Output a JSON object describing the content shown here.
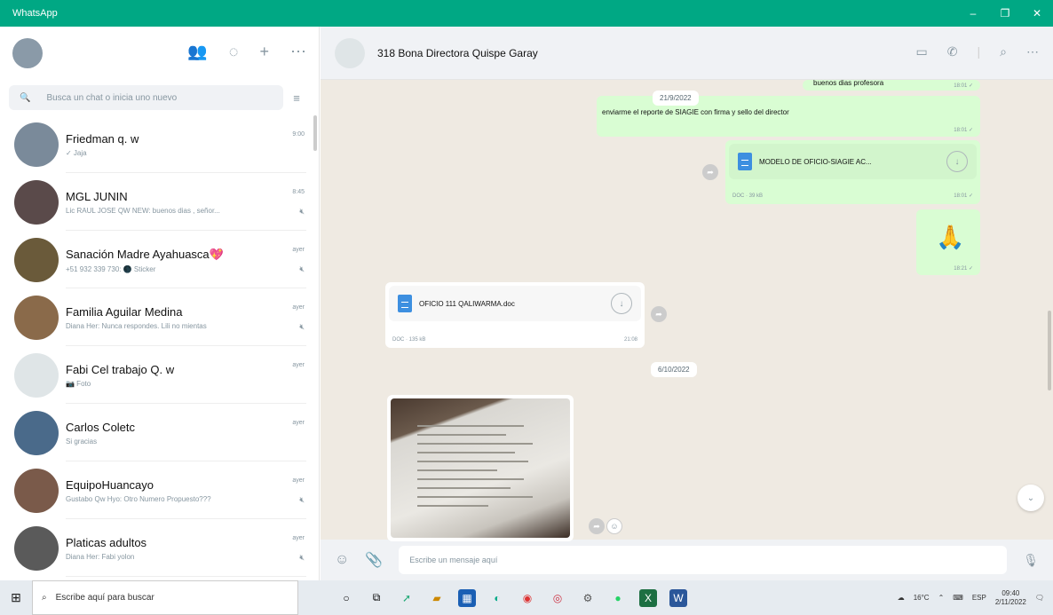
{
  "window": {
    "title": "WhatsApp",
    "controls": [
      "–",
      "❐",
      "✕"
    ]
  },
  "sidebar": {
    "search_placeholder": "Busca un chat o inicia uno nuevo",
    "chats": [
      {
        "name": "Friedman q. w",
        "preview": "✓ Jaja",
        "time": "9:00",
        "pinned": false,
        "avatar_color": "#7a8a9a"
      },
      {
        "name": "MGL JUNIN",
        "preview": "Lic RAUL JOSE QW NEW: buenos dias , señor...",
        "time": "8:45",
        "pinned": true,
        "avatar_color": "#5a4a4a"
      },
      {
        "name": "Sanación Madre Ayahuasca💖",
        "preview": "+51 932 339 730: 🌑 Sticker",
        "time": "ayer",
        "pinned": true,
        "avatar_color": "#6a5a3a"
      },
      {
        "name": "Familia Aguilar Medina",
        "preview": "Diana Her: Nunca respondes. Lili no mientas",
        "time": "ayer",
        "pinned": true,
        "avatar_color": "#8a6a4a"
      },
      {
        "name": "Fabi Cel trabajo Q. w",
        "preview": "📷 Foto",
        "time": "ayer",
        "pinned": false,
        "avatar_color": "#dfe5e7"
      },
      {
        "name": "Carlos Coletc",
        "preview": "Si gracias",
        "time": "ayer",
        "pinned": false,
        "avatar_color": "#4a6a8a"
      },
      {
        "name": "EquipoHuancayo",
        "preview": "Gustabo Qw Hyo: Otro Numero Propuesto???",
        "time": "ayer",
        "pinned": true,
        "avatar_color": "#7a5a4a"
      },
      {
        "name": "Platicas adultos",
        "preview": "Diana Her: Fabi yolon",
        "time": "ayer",
        "pinned": true,
        "avatar_color": "#5a5a5a"
      }
    ]
  },
  "conversation": {
    "contact_name": "318 Bona Directora Quispe Garay",
    "messages": {
      "top_partial": "buenos dias profesora",
      "top_partial_time": "18:01 ✓",
      "date1": "21/9/2022",
      "request_text": "enviarme el reporte de SIAGIE con firma y sello del director",
      "request_time": "18:01 ✓",
      "doc_out_name": "MODELO DE OFICIO-SIAGIE AC...",
      "doc_out_meta": "DOC · 39 kB",
      "doc_out_time": "18:01 ✓",
      "emoji": "🙏",
      "emoji_time": "18:21 ✓",
      "doc_in_name": "OFICIO 111 QALIWARMA.doc",
      "doc_in_meta": "DOC · 135 kB",
      "doc_in_time": "21:08",
      "date2": "6/10/2022"
    },
    "compose_placeholder": "Escribe un mensaje aquí"
  },
  "taskbar": {
    "search_placeholder": "Escribe aquí para buscar",
    "weather": "16°C",
    "lang": "ESP",
    "time": "09:40",
    "date": "2/11/2022"
  }
}
